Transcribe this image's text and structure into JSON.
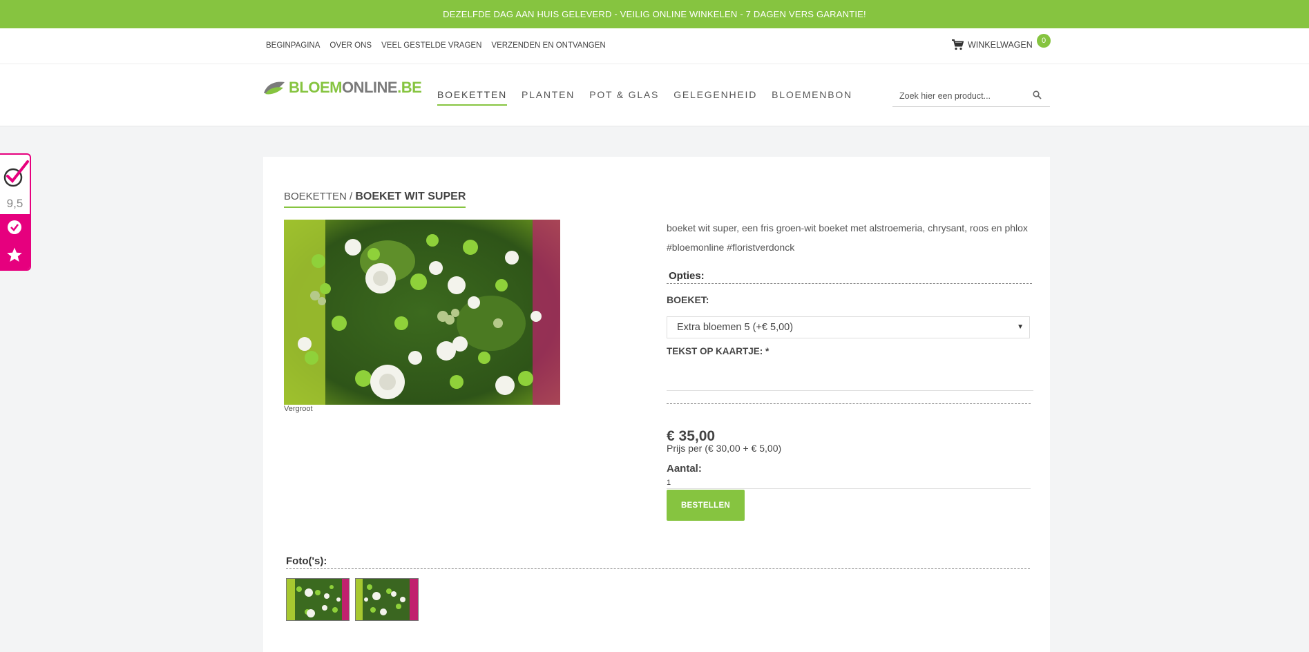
{
  "topbar": {
    "text": "DEZELFDE DAG AAN HUIS GELEVERD - VEILIG ONLINE WINKELEN - 7 DAGEN VERS GARANTIE!"
  },
  "subnav": {
    "links": [
      "BEGINPAGINA",
      "OVER ONS",
      "VEEL GESTELDE VRAGEN",
      "VERZENDEN EN ONTVANGEN"
    ],
    "cart_label": "WINKELWAGEN",
    "cart_count": "0"
  },
  "logo": {
    "part1": "BLOEM",
    "part2": "ONLINE",
    "part3": ".BE"
  },
  "mainnav": {
    "items": [
      "BOEKETTEN",
      "PLANTEN",
      "POT & GLAS",
      "GELEGENHEID",
      "BLOEMENBON"
    ]
  },
  "search": {
    "placeholder": "Zoek hier een product..."
  },
  "review_widget": {
    "score": "9,5"
  },
  "product": {
    "breadcrumb_parent": "BOEKETTEN",
    "breadcrumb_sep": " / ",
    "title": "BOEKET WIT SUPER",
    "image_caption": "Vergroot",
    "description": "boeket wit super, een fris groen-wit boeket met alstroemeria, chrysant, roos en phlox #bloemonline #floristverdonck",
    "options_heading": "Opties:",
    "boeket_label": "BOEKET:",
    "boeket_selected": "Extra bloemen 5 (+€ 5,00)",
    "card_text_label": "TEKST OP KAARTJE: *",
    "card_text_value": "",
    "price": "€ 35,00",
    "price_detail": "Prijs per (€ 30,00 + € 5,00)",
    "quantity_label": "Aantal:",
    "quantity_value": "1",
    "order_button": "BESTELLEN",
    "photos_heading": "Foto('s):"
  },
  "colors": {
    "brand_green": "#86c440",
    "review_pink": "#e6007e"
  }
}
